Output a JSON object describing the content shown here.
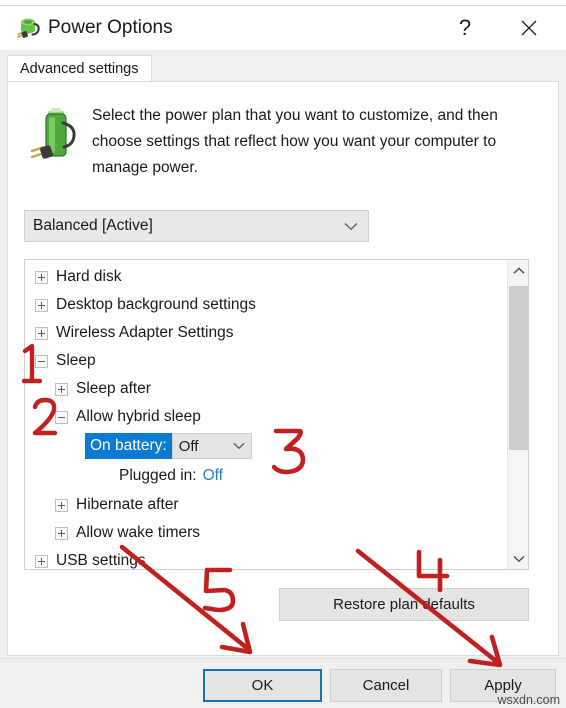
{
  "window": {
    "title": "Power Options",
    "icon": "power-plan-icon",
    "help_label": "?",
    "close_label": "✕"
  },
  "tabs": [
    {
      "label": "Advanced settings",
      "active": true
    }
  ],
  "description": {
    "icon": "battery-plug-icon",
    "text": "Select the power plan that you want to customize, and then choose settings that reflect how you want your computer to manage power."
  },
  "plan_selector": {
    "value": "Balanced [Active]",
    "chevron": "chevron-down-icon"
  },
  "tree": {
    "rows": [
      {
        "label": "Hard disk",
        "level": 0,
        "state": "collapsed"
      },
      {
        "label": "Desktop background settings",
        "level": 0,
        "state": "collapsed"
      },
      {
        "label": "Wireless Adapter Settings",
        "level": 0,
        "state": "collapsed"
      },
      {
        "label": "Sleep",
        "level": 0,
        "state": "expanded"
      },
      {
        "label": "Sleep after",
        "level": 1,
        "state": "collapsed"
      },
      {
        "label": "Allow hybrid sleep",
        "level": 1,
        "state": "expanded"
      },
      {
        "label": "Hibernate after",
        "level": 1,
        "state": "collapsed"
      },
      {
        "label": "Allow wake timers",
        "level": 1,
        "state": "collapsed"
      },
      {
        "label": "USB settings",
        "level": 0,
        "state": "collapsed"
      }
    ],
    "on_battery": {
      "label": "On battery:",
      "value": "Off",
      "highlight_color": "#0b7ad1",
      "chevron": "chevron-down-icon"
    },
    "plugged_in": {
      "label": "Plugged in:",
      "value": "Off",
      "value_color": "#2a7fc9"
    },
    "scrollbar": {
      "up_arrow": "chevron-up-icon",
      "down_arrow": "chevron-down-icon"
    }
  },
  "restore_button": {
    "label": "Restore plan defaults"
  },
  "buttons": {
    "ok": "OK",
    "cancel": "Cancel",
    "apply": "Apply"
  },
  "annotations": {
    "color": "#c02020",
    "markers": [
      {
        "id": "1",
        "text": "1"
      },
      {
        "id": "2",
        "text": "2"
      },
      {
        "id": "3",
        "text": "3"
      },
      {
        "id": "4",
        "text": "4"
      },
      {
        "id": "5",
        "text": "5"
      }
    ]
  },
  "watermark": {
    "text": "wsxdn.com"
  }
}
